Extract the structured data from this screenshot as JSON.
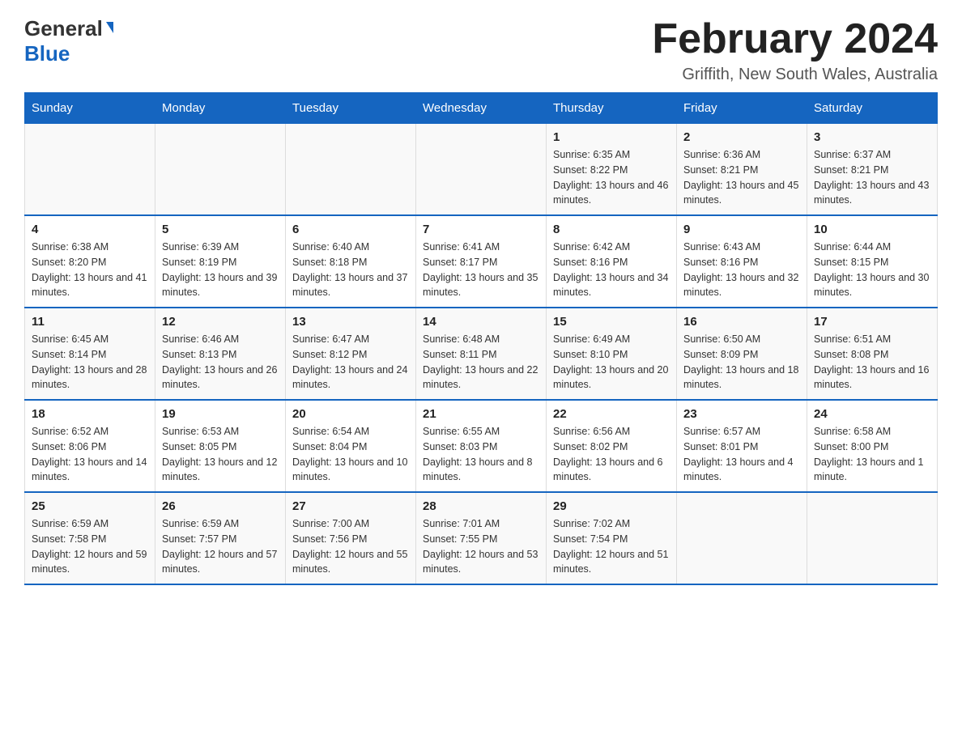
{
  "header": {
    "logo_general": "General",
    "logo_blue": "Blue",
    "title": "February 2024",
    "subtitle": "Griffith, New South Wales, Australia"
  },
  "days_of_week": [
    "Sunday",
    "Monday",
    "Tuesday",
    "Wednesday",
    "Thursday",
    "Friday",
    "Saturday"
  ],
  "weeks": [
    [
      {
        "day": "",
        "info": ""
      },
      {
        "day": "",
        "info": ""
      },
      {
        "day": "",
        "info": ""
      },
      {
        "day": "",
        "info": ""
      },
      {
        "day": "1",
        "info": "Sunrise: 6:35 AM\nSunset: 8:22 PM\nDaylight: 13 hours and 46 minutes."
      },
      {
        "day": "2",
        "info": "Sunrise: 6:36 AM\nSunset: 8:21 PM\nDaylight: 13 hours and 45 minutes."
      },
      {
        "day": "3",
        "info": "Sunrise: 6:37 AM\nSunset: 8:21 PM\nDaylight: 13 hours and 43 minutes."
      }
    ],
    [
      {
        "day": "4",
        "info": "Sunrise: 6:38 AM\nSunset: 8:20 PM\nDaylight: 13 hours and 41 minutes."
      },
      {
        "day": "5",
        "info": "Sunrise: 6:39 AM\nSunset: 8:19 PM\nDaylight: 13 hours and 39 minutes."
      },
      {
        "day": "6",
        "info": "Sunrise: 6:40 AM\nSunset: 8:18 PM\nDaylight: 13 hours and 37 minutes."
      },
      {
        "day": "7",
        "info": "Sunrise: 6:41 AM\nSunset: 8:17 PM\nDaylight: 13 hours and 35 minutes."
      },
      {
        "day": "8",
        "info": "Sunrise: 6:42 AM\nSunset: 8:16 PM\nDaylight: 13 hours and 34 minutes."
      },
      {
        "day": "9",
        "info": "Sunrise: 6:43 AM\nSunset: 8:16 PM\nDaylight: 13 hours and 32 minutes."
      },
      {
        "day": "10",
        "info": "Sunrise: 6:44 AM\nSunset: 8:15 PM\nDaylight: 13 hours and 30 minutes."
      }
    ],
    [
      {
        "day": "11",
        "info": "Sunrise: 6:45 AM\nSunset: 8:14 PM\nDaylight: 13 hours and 28 minutes."
      },
      {
        "day": "12",
        "info": "Sunrise: 6:46 AM\nSunset: 8:13 PM\nDaylight: 13 hours and 26 minutes."
      },
      {
        "day": "13",
        "info": "Sunrise: 6:47 AM\nSunset: 8:12 PM\nDaylight: 13 hours and 24 minutes."
      },
      {
        "day": "14",
        "info": "Sunrise: 6:48 AM\nSunset: 8:11 PM\nDaylight: 13 hours and 22 minutes."
      },
      {
        "day": "15",
        "info": "Sunrise: 6:49 AM\nSunset: 8:10 PM\nDaylight: 13 hours and 20 minutes."
      },
      {
        "day": "16",
        "info": "Sunrise: 6:50 AM\nSunset: 8:09 PM\nDaylight: 13 hours and 18 minutes."
      },
      {
        "day": "17",
        "info": "Sunrise: 6:51 AM\nSunset: 8:08 PM\nDaylight: 13 hours and 16 minutes."
      }
    ],
    [
      {
        "day": "18",
        "info": "Sunrise: 6:52 AM\nSunset: 8:06 PM\nDaylight: 13 hours and 14 minutes."
      },
      {
        "day": "19",
        "info": "Sunrise: 6:53 AM\nSunset: 8:05 PM\nDaylight: 13 hours and 12 minutes."
      },
      {
        "day": "20",
        "info": "Sunrise: 6:54 AM\nSunset: 8:04 PM\nDaylight: 13 hours and 10 minutes."
      },
      {
        "day": "21",
        "info": "Sunrise: 6:55 AM\nSunset: 8:03 PM\nDaylight: 13 hours and 8 minutes."
      },
      {
        "day": "22",
        "info": "Sunrise: 6:56 AM\nSunset: 8:02 PM\nDaylight: 13 hours and 6 minutes."
      },
      {
        "day": "23",
        "info": "Sunrise: 6:57 AM\nSunset: 8:01 PM\nDaylight: 13 hours and 4 minutes."
      },
      {
        "day": "24",
        "info": "Sunrise: 6:58 AM\nSunset: 8:00 PM\nDaylight: 13 hours and 1 minute."
      }
    ],
    [
      {
        "day": "25",
        "info": "Sunrise: 6:59 AM\nSunset: 7:58 PM\nDaylight: 12 hours and 59 minutes."
      },
      {
        "day": "26",
        "info": "Sunrise: 6:59 AM\nSunset: 7:57 PM\nDaylight: 12 hours and 57 minutes."
      },
      {
        "day": "27",
        "info": "Sunrise: 7:00 AM\nSunset: 7:56 PM\nDaylight: 12 hours and 55 minutes."
      },
      {
        "day": "28",
        "info": "Sunrise: 7:01 AM\nSunset: 7:55 PM\nDaylight: 12 hours and 53 minutes."
      },
      {
        "day": "29",
        "info": "Sunrise: 7:02 AM\nSunset: 7:54 PM\nDaylight: 12 hours and 51 minutes."
      },
      {
        "day": "",
        "info": ""
      },
      {
        "day": "",
        "info": ""
      }
    ]
  ]
}
